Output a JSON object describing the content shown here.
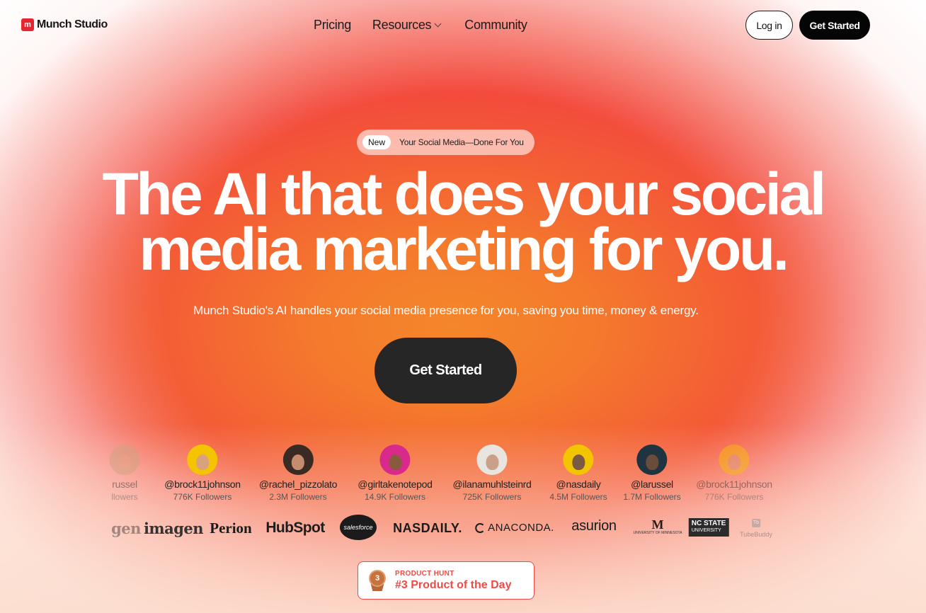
{
  "brand": {
    "logo_letter": "m",
    "name": "Munch Studio",
    "accent": "#e3262f"
  },
  "nav": {
    "links": [
      "Pricing",
      "Resources",
      "Community"
    ],
    "login": "Log in",
    "get_started": "Get Started"
  },
  "hero": {
    "badge_new": "New",
    "badge_text": "Your Social Media—Done For You",
    "headline_line1": "The AI that does your social",
    "headline_line2": "media marketing for you.",
    "subtitle": "Munch Studio's AI handles your social media presence for you, saving you time, money & energy.",
    "cta": "Get Started"
  },
  "creators": [
    {
      "handle": "russel",
      "followers": "llowers",
      "avatar_color": "#c9a37f"
    },
    {
      "handle": "@brock11johnson",
      "followers": "776K Followers",
      "avatar_color": "#f5c400"
    },
    {
      "handle": "@rachel_pizzolato",
      "followers": "2.3M Followers",
      "avatar_color": "#3a2a24"
    },
    {
      "handle": "@girltakenotepod",
      "followers": "14.9K Followers",
      "avatar_color": "#d92a8c"
    },
    {
      "handle": "@ilanamuhlsteinrd",
      "followers": "725K Followers",
      "avatar_color": "#e8e4e0"
    },
    {
      "handle": "@nasdaily",
      "followers": "4.5M Followers",
      "avatar_color": "#f3c500"
    },
    {
      "handle": "@larussel",
      "followers": "1.7M Followers",
      "avatar_color": "#1f3440"
    },
    {
      "handle": "@brock11johnson",
      "followers": "776K Followers",
      "avatar_color": "#f5c400"
    }
  ],
  "logos": {
    "imagen_partial": "gen",
    "imagen": "imagen",
    "perion": "Perion",
    "hubspot": "HubSpot",
    "salesforce": "salesforce",
    "nasdaily": "NASDAILY.",
    "anaconda": "ANACONDA.",
    "asurion": "asurion",
    "umn_mark": "M",
    "umn_text": "UNIVERSITY OF MINNESOTA",
    "ncstate_a": "NC STATE",
    "ncstate_b": "UNIVERSITY",
    "tube_box": "Tb",
    "tube_text": "TubeBuddy"
  },
  "product_hunt": {
    "rank": "3",
    "label": "PRODUCT HUNT",
    "title": "#3 Product of the Day",
    "color": "#ef4b45"
  }
}
